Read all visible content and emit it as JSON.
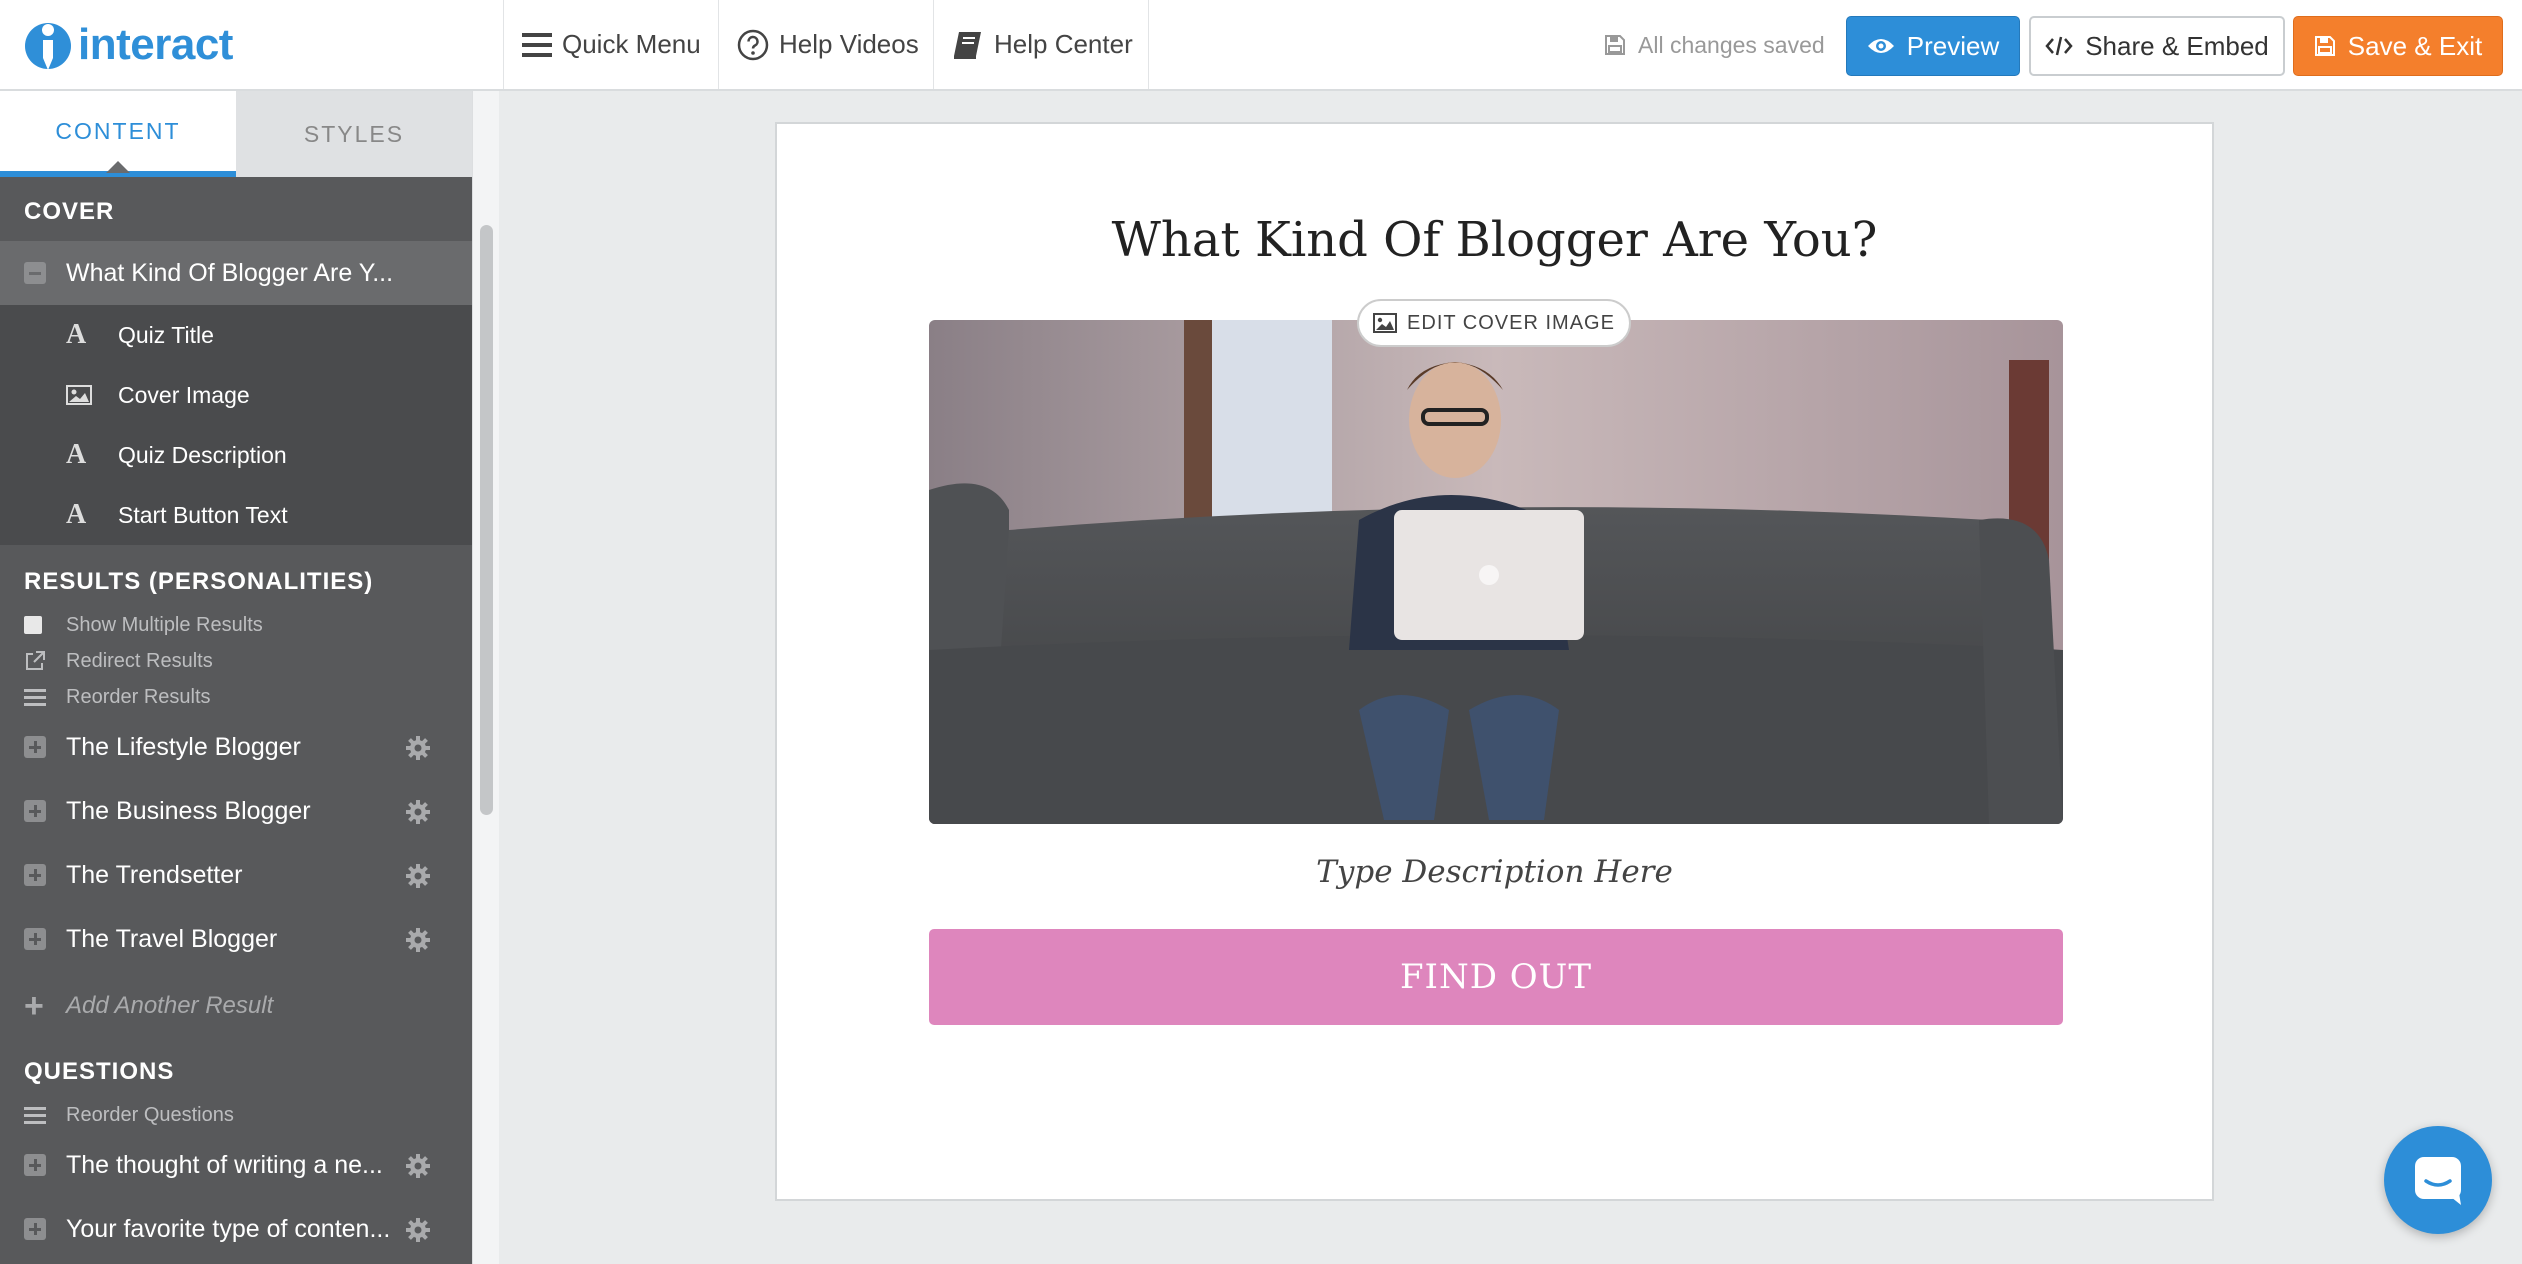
{
  "app": {
    "logo_text": "interact"
  },
  "topnav": {
    "quick_menu": "Quick Menu",
    "help_videos": "Help Videos",
    "help_center": "Help Center"
  },
  "status": {
    "saved_text": "All changes saved"
  },
  "buttons": {
    "preview": "Preview",
    "share_embed": "Share & Embed",
    "save_exit": "Save & Exit"
  },
  "colors": {
    "brand_blue": "#2d8ed8",
    "save_orange": "#f47f2c",
    "find_out_pink": "#de86bd",
    "sidebar_bg": "#58595b"
  },
  "sidebar": {
    "tabs": [
      {
        "label": "CONTENT",
        "active": true
      },
      {
        "label": "STYLES",
        "active": false
      }
    ],
    "cover": {
      "heading": "COVER",
      "item_label": "What Kind Of Blogger Are Y...",
      "sub_items": [
        {
          "label": "Quiz Title",
          "icon": "text-icon"
        },
        {
          "label": "Cover Image",
          "icon": "image-icon"
        },
        {
          "label": "Quiz Description",
          "icon": "text-icon"
        },
        {
          "label": "Start Button Text",
          "icon": "text-icon"
        }
      ]
    },
    "results": {
      "heading": "RESULTS (PERSONALITIES)",
      "options": [
        {
          "label": "Show Multiple Results",
          "icon": "checkbox-icon"
        },
        {
          "label": "Redirect Results",
          "icon": "external-link-icon"
        },
        {
          "label": "Reorder Results",
          "icon": "reorder-icon"
        }
      ],
      "items": [
        {
          "label": "The Lifestyle Blogger"
        },
        {
          "label": "The Business Blogger"
        },
        {
          "label": "The Trendsetter"
        },
        {
          "label": "The Travel Blogger"
        }
      ],
      "add_label": "Add Another Result"
    },
    "questions": {
      "heading": "QUESTIONS",
      "reorder_label": "Reorder Questions",
      "items": [
        {
          "label": "The thought of writing a ne..."
        },
        {
          "label": "Your favorite type of conten..."
        }
      ]
    }
  },
  "canvas": {
    "quiz_title": "What Kind Of Blogger Are You?",
    "edit_cover_label": "EDIT COVER IMAGE",
    "description_placeholder": "Type Description Here",
    "start_button": "FIND OUT"
  }
}
